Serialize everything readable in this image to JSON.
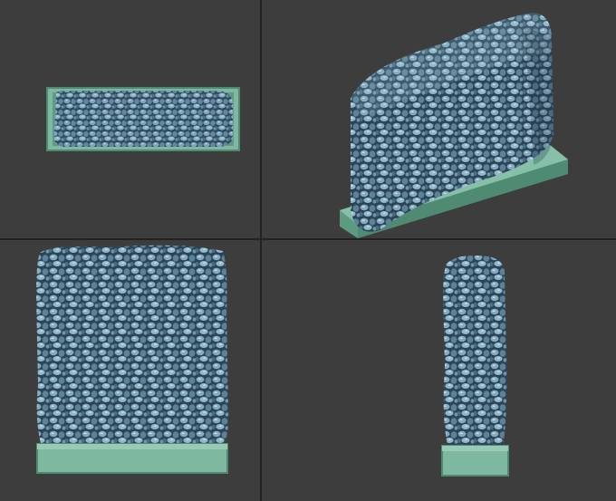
{
  "viewports": [
    {
      "id": "top",
      "name": "top-view-viewport"
    },
    {
      "id": "perspective",
      "name": "perspective-view-viewport"
    },
    {
      "id": "front",
      "name": "front-view-viewport"
    },
    {
      "id": "side",
      "name": "side-view-viewport"
    }
  ],
  "colors": {
    "background": "#3d3d3d",
    "divider": "#222222",
    "base_fill": "#7fb8a0",
    "base_edge": "#4f8a73",
    "stone_light": "#9fc0d4",
    "stone_mid": "#5f879e",
    "stone_dark": "#2f4a5c"
  }
}
